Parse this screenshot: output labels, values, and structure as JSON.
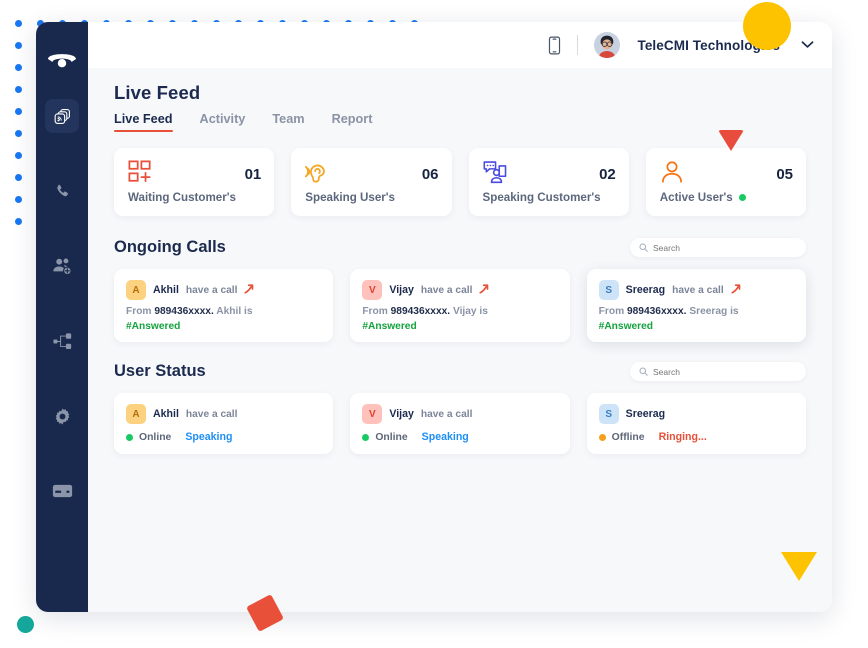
{
  "window": {
    "topbar": {
      "mobile_icon": "mobile-device-icon",
      "org_name": "TeleCMI Technologies",
      "caret": "chevron-down-icon"
    }
  },
  "sidebar": {
    "logo": "telecmi-phone-logo",
    "items": [
      {
        "name": "live-feed",
        "icon": "broadcast-stack-icon",
        "active": true
      },
      {
        "name": "calls",
        "icon": "phone-icon",
        "active": false
      },
      {
        "name": "users",
        "icon": "users-add-icon",
        "active": false
      },
      {
        "name": "flows",
        "icon": "call-flow-icon",
        "active": false
      },
      {
        "name": "settings",
        "icon": "gear-icon",
        "active": false
      },
      {
        "name": "billing",
        "icon": "credit-card-icon",
        "active": false
      }
    ]
  },
  "page": {
    "title": "Live Feed",
    "tabs": [
      {
        "label": "Live Feed",
        "active": true
      },
      {
        "label": "Activity",
        "active": false
      },
      {
        "label": "Team",
        "active": false
      },
      {
        "label": "Report",
        "active": false
      }
    ]
  },
  "stats": [
    {
      "icon": "waiting-grid-plus-icon",
      "value": "01",
      "label": "Waiting Customer's",
      "dot": false,
      "color": "#e8503a"
    },
    {
      "icon": "ear-listening-icon",
      "value": "06",
      "label": "Speaking User's",
      "dot": false,
      "color": "#f5a623"
    },
    {
      "icon": "speaking-customer-icon",
      "value": "02",
      "label": "Speaking Customer's",
      "dot": false,
      "color": "#4a4ae0"
    },
    {
      "icon": "person-icon",
      "value": "05",
      "label": "Active User's",
      "dot": true,
      "color": "#f97316"
    }
  ],
  "ongoing_calls": {
    "title": "Ongoing Calls",
    "search": {
      "placeholder": "Search",
      "value": "",
      "icon": "search-icon"
    },
    "cards": [
      {
        "initial": "A",
        "badge_class": "a",
        "name": "Akhil",
        "action": "have a call",
        "arrow": "⤳",
        "from_prefix": "From",
        "number": "989436xxxx.",
        "from_suffix": "Akhil is",
        "tag": "#Answered",
        "highlight": false
      },
      {
        "initial": "V",
        "badge_class": "v",
        "name": "Vijay",
        "action": "have a call",
        "arrow": "⤳",
        "from_prefix": "From",
        "number": "989436xxxx.",
        "from_suffix": "Vijay is",
        "tag": "#Answered",
        "highlight": false
      },
      {
        "initial": "S",
        "badge_class": "s",
        "name": "Sreerag",
        "action": "have a call",
        "arrow": "⤳",
        "from_prefix": "From",
        "number": "989436xxxx.",
        "from_suffix": "Sreerag is",
        "tag": "#Answered",
        "highlight": true
      }
    ]
  },
  "user_status": {
    "title": "User Status",
    "search": {
      "placeholder": "Search",
      "value": "",
      "icon": "search-icon"
    },
    "cards": [
      {
        "initial": "A",
        "badge_class": "a",
        "name": "Akhil",
        "action": "have a call",
        "state": "Online",
        "state_dot": "online",
        "activity": "Speaking",
        "activity_class": "speaking"
      },
      {
        "initial": "V",
        "badge_class": "v",
        "name": "Vijay",
        "action": "have a call",
        "state": "Online",
        "state_dot": "online",
        "activity": "Speaking",
        "activity_class": "speaking"
      },
      {
        "initial": "S",
        "badge_class": "s",
        "name": "Sreerag",
        "action": "",
        "state": "Offline",
        "state_dot": "offline",
        "activity": "Ringing...",
        "activity_class": "ringing"
      }
    ]
  },
  "decor": {
    "dot_color": "#1878f2",
    "circle_yellow": "#fdc300",
    "circle_teal": "#15a79b",
    "triangle_red": "#e74c3c",
    "triangle_yellow": "#fdc300",
    "square_red": "#e8503a"
  }
}
